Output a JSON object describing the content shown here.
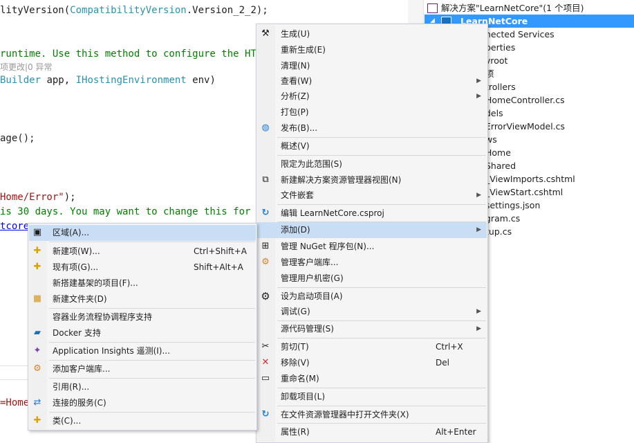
{
  "editor": {
    "line1": {
      "a": "lityVersion(",
      "b": "CompatibilityVersion",
      "c": ".Version_2_2);"
    },
    "line2": "runtime. Use this method to configure the HT",
    "codelens": "项更改|0 异常",
    "line3": {
      "a": "Builder",
      "b": " app, ",
      "c": "IHostingEnvironment",
      "d": " env)"
    },
    "line4": "age();",
    "line5": {
      "a": "Home/Error\"",
      "b": ");"
    },
    "line6": "is 30 days. You may want to change this for",
    "line7": "tcore",
    "line8": "=Home"
  },
  "solution": {
    "root": "解决方案\"LearnNetCore\"(1 个项目)",
    "project": "LearnNetCore",
    "items": [
      "nected Services",
      "perties",
      "vroot",
      "项",
      "trollers",
      "HomeController.cs",
      "dels",
      "ErrorViewModel.cs",
      "ws",
      "Home",
      "Shared",
      "_ViewImports.cshtml",
      "_ViewStart.cshtml",
      "settings.json",
      "gram.cs",
      "tup.cs"
    ]
  },
  "context_menu": {
    "items": [
      {
        "label": "生成(U)",
        "icon": "build-icon"
      },
      {
        "label": "重新生成(E)"
      },
      {
        "label": "清理(N)"
      },
      {
        "label": "查看(W)",
        "submenu": true
      },
      {
        "label": "分析(Z)",
        "submenu": true
      },
      {
        "label": "打包(P)"
      },
      {
        "label": "发布(B)...",
        "icon": "globe-icon"
      },
      {
        "label": "概述(V)"
      },
      {
        "label": "限定为此范围(S)"
      },
      {
        "label": "新建解决方案资源管理器视图(N)",
        "icon": "new-view-icon"
      },
      {
        "label": "文件嵌套",
        "submenu": true
      },
      {
        "label": "编辑 LearnNetCore.csproj",
        "icon": "edit-project-icon"
      },
      {
        "label": "添加(D)",
        "submenu": true,
        "highlighted": true
      },
      {
        "label": "管理 NuGet 程序包(N)...",
        "icon": "nuget-icon"
      },
      {
        "label": "管理客户端库...",
        "icon": "client-library-icon"
      },
      {
        "label": "管理用户机密(G)"
      },
      {
        "label": "设为启动项目(A)",
        "icon": "gear-icon"
      },
      {
        "label": "调试(G)",
        "submenu": true
      },
      {
        "label": "源代码管理(S)",
        "submenu": true
      },
      {
        "label": "剪切(T)",
        "shortcut": "Ctrl+X",
        "icon": "scissors-icon"
      },
      {
        "label": "移除(V)",
        "shortcut": "Del",
        "icon": "remove-icon"
      },
      {
        "label": "重命名(M)",
        "icon": "rename-icon"
      },
      {
        "label": "卸载项目(L)"
      },
      {
        "label": "在文件资源管理器中打开文件夹(X)",
        "icon": "open-folder-icon"
      },
      {
        "label": "属性(R)",
        "shortcut": "Alt+Enter"
      }
    ]
  },
  "add_submenu": {
    "items": [
      {
        "label": "区域(A)...",
        "highlighted": true,
        "icon": "area-icon"
      },
      {
        "label": "新建项(W)...",
        "shortcut": "Ctrl+Shift+A",
        "icon": "new-item-icon"
      },
      {
        "label": "现有项(G)...",
        "shortcut": "Shift+Alt+A",
        "icon": "existing-item-icon"
      },
      {
        "label": "新搭建基架的项目(F)..."
      },
      {
        "label": "新建文件夹(D)",
        "icon": "new-folder-icon"
      },
      {
        "label": "容器业务流程协调程序支持"
      },
      {
        "label": "Docker 支持",
        "icon": "docker-icon"
      },
      {
        "label": "Application Insights 遥测(I)...",
        "icon": "app-insights-icon"
      },
      {
        "label": "添加客户端库...",
        "icon": "client-library-icon"
      },
      {
        "label": "引用(R)..."
      },
      {
        "label": "连接的服务(C)",
        "icon": "connected-services-icon"
      },
      {
        "label": "类(C)...",
        "icon": "class-icon"
      }
    ]
  },
  "colors": {
    "accent": "#3399ff",
    "highlight": "#c9def5",
    "menu_bg": "#f5f5f5",
    "comment": "#008000",
    "type": "#2b91af",
    "string": "#a31515"
  }
}
